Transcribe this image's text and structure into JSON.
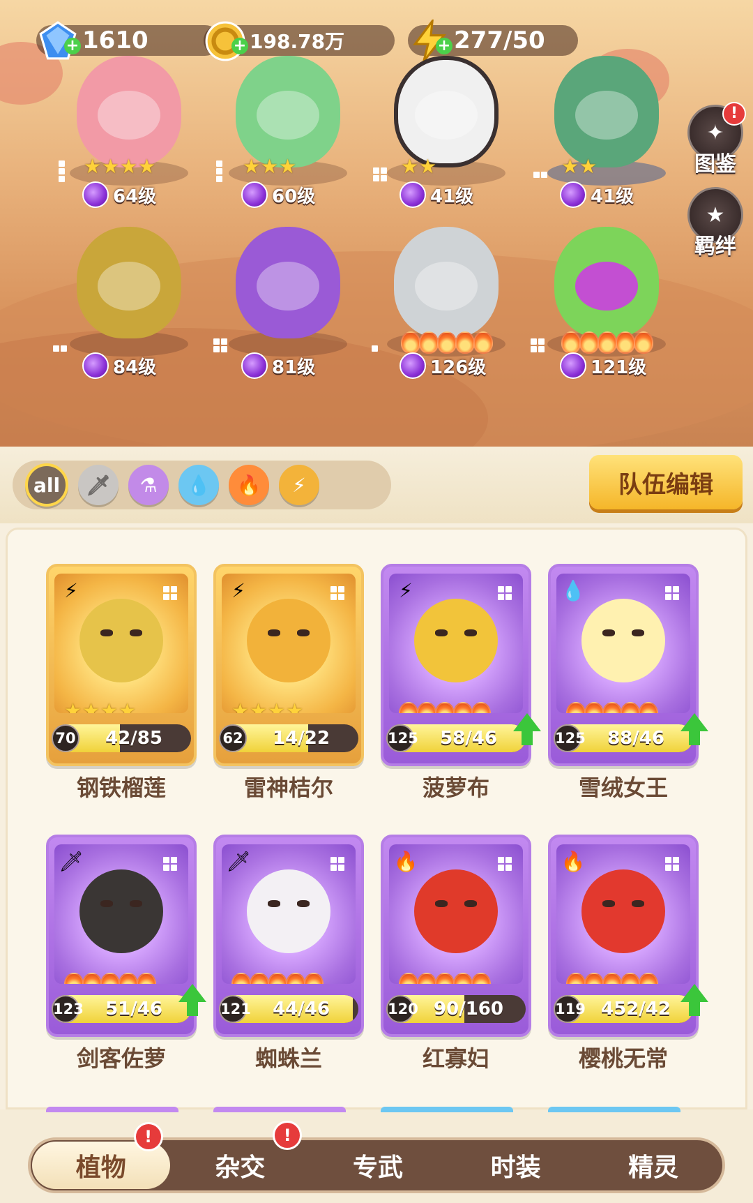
{
  "currencies": [
    {
      "name": "gem",
      "value": "1610",
      "color": "#3d8ef0",
      "icon": "gem-icon"
    },
    {
      "name": "coin",
      "value": "198.78万",
      "color": "#f6c23a",
      "icon": "coin-icon"
    },
    {
      "name": "energy",
      "value": "277/50",
      "color": "#ffd23a",
      "icon": "lightning-icon"
    }
  ],
  "team": [
    {
      "level": "64级",
      "stars": 4,
      "color": "#f29aa6"
    },
    {
      "level": "60级",
      "stars": 3,
      "color": "#7fd28a"
    },
    {
      "level": "41级",
      "stars": 2,
      "color": "#f0f0f0"
    },
    {
      "level": "41级",
      "stars": 2,
      "color": "#5aa67a"
    },
    {
      "level": "84级",
      "flames": 0,
      "color": "#c9a63a"
    },
    {
      "level": "81级",
      "flames": 0,
      "color": "#9a5ad6"
    },
    {
      "level": "126级",
      "flames": 5,
      "color": "#cfd3d6"
    },
    {
      "level": "121级",
      "flames": 5,
      "color": "#7dd45a"
    }
  ],
  "side": {
    "codex": "图鉴",
    "codex_badge": "!",
    "bond": "羁绊"
  },
  "filters": {
    "all": "all"
  },
  "team_edit": "队伍编辑",
  "cards": [
    {
      "name": "钢铁榴莲",
      "level": "70",
      "count": "42/85",
      "progress": 0.49,
      "tier": "gold",
      "element": "lightning-icon",
      "stars": 4,
      "upgrade": false,
      "color": "#e6c34a"
    },
    {
      "name": "雷神桔尔",
      "level": "62",
      "count": "14/22",
      "progress": 0.64,
      "tier": "gold",
      "element": "lightning-icon",
      "stars": 4,
      "upgrade": false,
      "color": "#f2b23a"
    },
    {
      "name": "菠萝布",
      "level": "125",
      "count": "58/46",
      "progress": 1,
      "tier": "purple",
      "element": "lightning-icon",
      "flames": 5,
      "upgrade": true,
      "color": "#f2c43a"
    },
    {
      "name": "雪绒女王",
      "level": "125",
      "count": "88/46",
      "progress": 1,
      "tier": "purple",
      "element": "water-icon",
      "flames": 5,
      "upgrade": true,
      "color": "#fff1b0"
    },
    {
      "name": "剑客佐萝",
      "level": "123",
      "count": "51/46",
      "progress": 1,
      "tier": "purple",
      "element": "sword-icon",
      "flames": 5,
      "upgrade": true,
      "color": "#3a3634"
    },
    {
      "name": "蜘蛛兰",
      "level": "121",
      "count": "44/46",
      "progress": 0.96,
      "tier": "purple",
      "element": "sword-icon",
      "flames": 5,
      "upgrade": false,
      "color": "#f3f0f4"
    },
    {
      "name": "红寡妇",
      "level": "120",
      "count": "90/160",
      "progress": 0.56,
      "tier": "purple",
      "element": "fire-icon",
      "flames": 5,
      "upgrade": false,
      "color": "#e03a2a"
    },
    {
      "name": "樱桃无常",
      "level": "119",
      "count": "452/42",
      "progress": 1,
      "tier": "purple",
      "element": "fire-icon",
      "flames": 5,
      "upgrade": true,
      "color": "#e2392e"
    }
  ],
  "tabs": [
    {
      "label": "植物",
      "active": true,
      "badge": "!"
    },
    {
      "label": "杂交",
      "active": false,
      "badge": "!"
    },
    {
      "label": "专武",
      "active": false,
      "badge": ""
    },
    {
      "label": "时装",
      "active": false,
      "badge": ""
    },
    {
      "label": "精灵",
      "active": false,
      "badge": ""
    }
  ]
}
